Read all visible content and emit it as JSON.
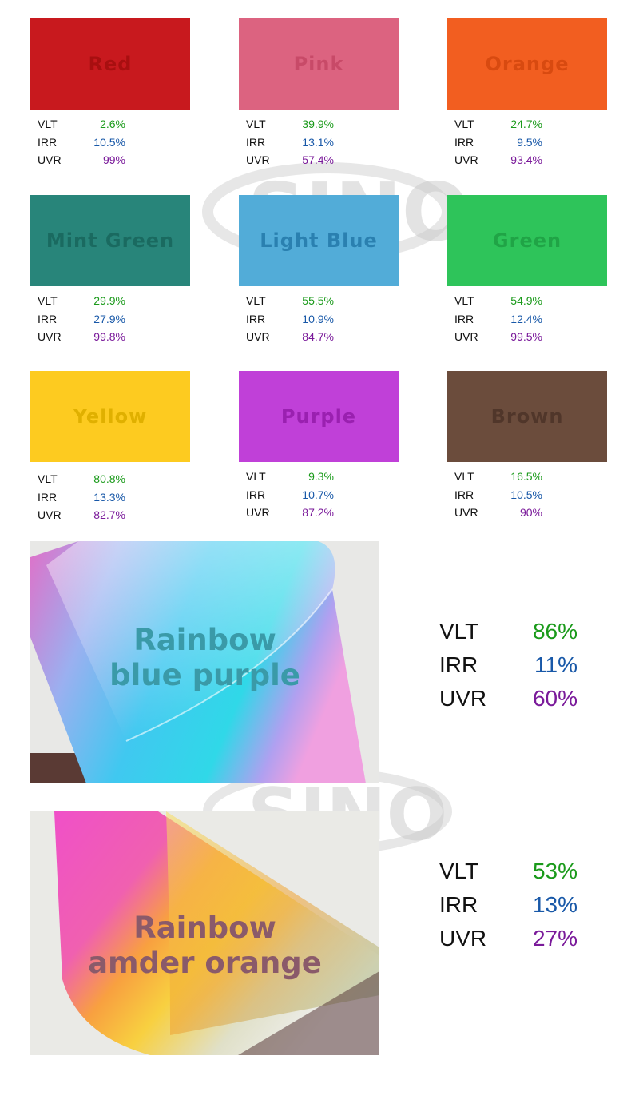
{
  "spec_labels": {
    "vlt": "VLT",
    "irr": "IRR",
    "uvr": "UVR"
  },
  "colors": {
    "vlt_value": "#1a9a1a",
    "irr_value": "#1858a8",
    "uvr_value": "#7a1a9a"
  },
  "watermark": {
    "text": "SINO"
  },
  "swatches": [
    {
      "name": "Red",
      "color": "#c8191e",
      "label_color": "#a80f10",
      "vlt": "2.6%",
      "irr": "10.5%",
      "uvr": "99%"
    },
    {
      "name": "Pink",
      "color": "#dc6380",
      "label_color": "#c84a68",
      "vlt": "39.9%",
      "irr": "13.1%",
      "uvr": "57.4%"
    },
    {
      "name": "Orange",
      "color": "#f25e20",
      "label_color": "#d84a10",
      "vlt": "24.7%",
      "irr": "9.5%",
      "uvr": "93.4%"
    },
    {
      "name": "Mint Green",
      "color": "#28857a",
      "label_color": "#1a6a60",
      "vlt": "29.9%",
      "irr": "27.9%",
      "uvr": "99.8%"
    },
    {
      "name": "Light Blue",
      "color": "#52acd8",
      "label_color": "#2a80b0",
      "vlt": "55.5%",
      "irr": "10.9%",
      "uvr": "84.7%"
    },
    {
      "name": "Green",
      "color": "#2ec45a",
      "label_color": "#20a446",
      "vlt": "54.9%",
      "irr": "12.4%",
      "uvr": "99.5%"
    },
    {
      "name": "Yellow",
      "color": "#fdcb20",
      "label_color": "#e0b000",
      "vlt": "80.8%",
      "irr": "13.3%",
      "uvr": "82.7%"
    },
    {
      "name": "Purple",
      "color": "#c040d8",
      "label_color": "#9a20b0",
      "vlt": "9.3%",
      "irr": "10.7%",
      "uvr": "87.2%"
    },
    {
      "name": "Brown",
      "color": "#6b4c3c",
      "label_color": "#50362a",
      "vlt": "16.5%",
      "irr": "10.5%",
      "uvr": "90%"
    }
  ],
  "rainbow_films": [
    {
      "name_line1": "Rainbow",
      "name_line2": "blue purple",
      "label_color": "#3a9aa8",
      "vlt": "86%",
      "irr": "11%",
      "uvr": "60%"
    },
    {
      "name_line1": "Rainbow",
      "name_line2": "amder orange",
      "label_color": "#8a5a6a",
      "vlt": "53%",
      "irr": "13%",
      "uvr": "27%"
    }
  ]
}
